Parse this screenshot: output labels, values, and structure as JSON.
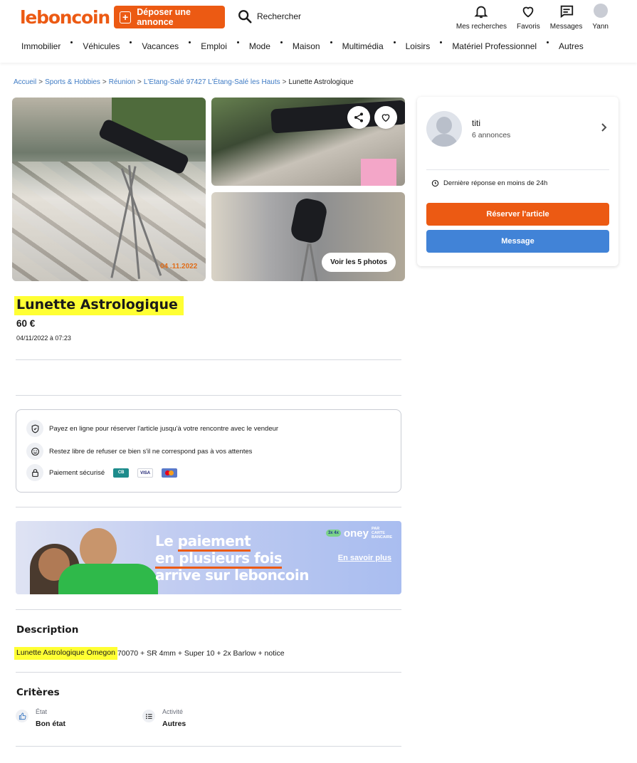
{
  "header": {
    "logo": "leboncoin",
    "post_button": "Déposer une annonce",
    "search_label": "Rechercher",
    "icons": [
      {
        "icon": "bell-icon",
        "label": "Mes recherches"
      },
      {
        "icon": "heart-icon",
        "label": "Favoris"
      },
      {
        "icon": "message-icon",
        "label": "Messages"
      },
      {
        "icon": "user-avatar-icon",
        "label": "Yann"
      }
    ],
    "nav": [
      "Immobilier",
      "Véhicules",
      "Vacances",
      "Emploi",
      "Mode",
      "Maison",
      "Multimédia",
      "Loisirs",
      "Matériel Professionnel",
      "Autres"
    ]
  },
  "breadcrumb": {
    "items": [
      "Accueil",
      "Sports & Hobbies",
      "Réunion",
      "L'Etang-Salé 97427 L'Étang-Salé les Hauts"
    ],
    "separator": ">",
    "current": "Lunette Astrologique"
  },
  "gallery": {
    "see_photos": "Voir les 5 photos",
    "share_icon": "share-icon",
    "favorite_icon": "heart-icon",
    "photo_stamp": "04 .11.2022"
  },
  "listing": {
    "title": "Lunette Astrologique",
    "price": "60 €",
    "date": "04/11/2022 à 07:23"
  },
  "payment": {
    "rows": [
      {
        "icon": "shield-icon",
        "text": "Payez en ligne pour réserver l'article jusqu'à votre rencontre avec le vendeur"
      },
      {
        "icon": "smile-icon",
        "text": "Restez libre de refuser ce bien s'il ne correspond pas à vos attentes"
      },
      {
        "icon": "lock-icon",
        "text": "Paiement sécurisé"
      }
    ],
    "cards": [
      {
        "label": "CB",
        "color": "#1e8c8c"
      },
      {
        "label": "VISA",
        "color": "#1a1f71"
      },
      {
        "label": "",
        "color": "#eb001b"
      }
    ]
  },
  "banner": {
    "line1a": "Le ",
    "line1b": "paiement",
    "line2a": "en plusieurs fois",
    "line3": "arrive sur leboncoin",
    "brand": "oney",
    "brand_pills": "3x 4x",
    "brand_small": "PAR CARTE BANCAIRE",
    "link": "En savoir plus"
  },
  "description": {
    "heading": "Description",
    "highlighted": "Lunette Astrologique Omegon",
    "rest": " 70070 + SR 4mm + Super 10 + 2x Barlow + notice"
  },
  "criteria": {
    "heading": "Critères",
    "items": [
      {
        "icon": "thumbs-up-icon",
        "label": "État",
        "value": "Bon état"
      },
      {
        "icon": "list-icon",
        "label": "Activité",
        "value": "Autres"
      }
    ]
  },
  "seller": {
    "name": "titi",
    "count": "6 annonces",
    "response": "Dernière réponse en moins de 24h",
    "reserve_button": "Réserver l'article",
    "message_button": "Message"
  },
  "colors": {
    "brand_orange": "#ec5a13",
    "message_blue": "#4183d7",
    "highlight_yellow": "#ffff33",
    "link_blue": "#3f7bc4"
  }
}
